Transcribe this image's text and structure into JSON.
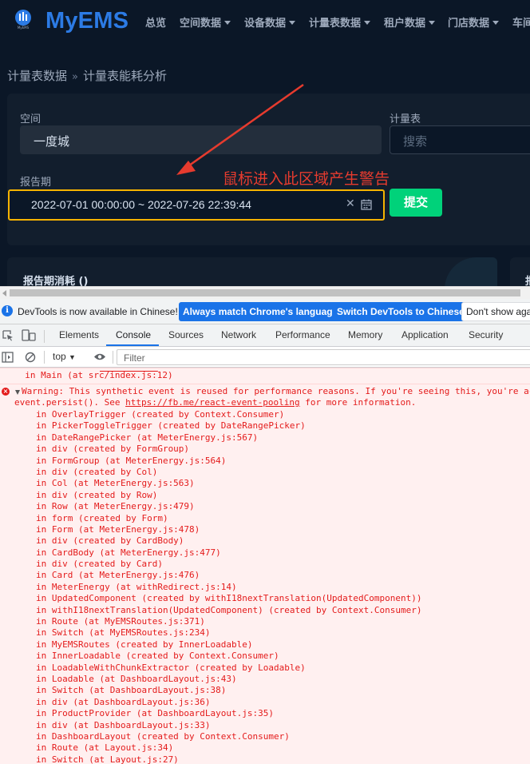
{
  "app": {
    "brand": "MyEMS",
    "logo_sub": "MyEMS",
    "nav": [
      {
        "label": "总览",
        "dropdown": false
      },
      {
        "label": "空间数据",
        "dropdown": true
      },
      {
        "label": "设备数据",
        "dropdown": true
      },
      {
        "label": "计量表数据",
        "dropdown": true
      },
      {
        "label": "租户数据",
        "dropdown": true
      },
      {
        "label": "门店数据",
        "dropdown": true
      },
      {
        "label": "车间",
        "dropdown": false
      }
    ],
    "breadcrumb": {
      "parent": "计量表数据",
      "separator": "»",
      "current": "计量表能耗分析"
    },
    "form": {
      "space_label": "空间",
      "space_value": "一度城",
      "meter_label": "计量表",
      "meter_placeholder": "搜索",
      "period_label": "报告期",
      "period_value": "2022-07-01 00:00:00 ~ 2022-07-26 22:39:44",
      "clear_glyph": "✕",
      "submit_label": "提交"
    },
    "annotation": "鼠标进入此区域产生警告",
    "section_title": "报告期消耗 ()",
    "section_title_2": "报"
  },
  "devtools": {
    "info_icon": "i",
    "info_text": "DevTools is now available in Chinese!",
    "btn_match": "Always match Chrome's language",
    "btn_switch": "Switch DevTools to Chinese",
    "btn_dont": "Don't show again",
    "tabs": [
      "Elements",
      "Console",
      "Sources",
      "Network",
      "Performance",
      "Memory",
      "Application",
      "Security"
    ],
    "active_tab": "Console",
    "context": "top",
    "filter_placeholder": "Filter",
    "colors": {
      "accent": "#1a73e8",
      "error": "#e41b1b",
      "error_bg": "#fff0f0"
    }
  },
  "console": {
    "top_cut": "           ",
    "top_line": "  in Main (at src/index.js:12)",
    "warning_line1": "Warning: This synthetic event is reused for performance reasons. If you're seeing this, you're accessing",
    "warning_line2_prefix": "event.persist(). See ",
    "warning_link": "https://fb.me/react-event-pooling",
    "warning_line2_suffix": " for more information.",
    "stack": [
      "in OverlayTrigger (created by Context.Consumer)",
      "in PickerToggleTrigger (created by DateRangePicker)",
      "in DateRangePicker (at MeterEnergy.js:567)",
      "in div (created by FormGroup)",
      "in FormGroup (at MeterEnergy.js:564)",
      "in div (created by Col)",
      "in Col (at MeterEnergy.js:563)",
      "in div (created by Row)",
      "in Row (at MeterEnergy.js:479)",
      "in form (created by Form)",
      "in Form (at MeterEnergy.js:478)",
      "in div (created by CardBody)",
      "in CardBody (at MeterEnergy.js:477)",
      "in div (created by Card)",
      "in Card (at MeterEnergy.js:476)",
      "in MeterEnergy (at withRedirect.js:14)",
      "in UpdatedComponent (created by withI18nextTranslation(UpdatedComponent))",
      "in withI18nextTranslation(UpdatedComponent) (created by Context.Consumer)",
      "in Route (at MyEMSRoutes.js:371)",
      "in Switch (at MyEMSRoutes.js:234)",
      "in MyEMSRoutes (created by InnerLoadable)",
      "in InnerLoadable (created by Context.Consumer)",
      "in LoadableWithChunkExtractor (created by Loadable)",
      "in Loadable (at DashboardLayout.js:43)",
      "in Switch (at DashboardLayout.js:38)",
      "in div (at DashboardLayout.js:36)",
      "in ProductProvider (at DashboardLayout.js:35)",
      "in div (at DashboardLayout.js:33)",
      "in DashboardLayout (created by Context.Consumer)",
      "in Route (at Layout.js:34)",
      "in Switch (at Layout.js:27)"
    ]
  }
}
